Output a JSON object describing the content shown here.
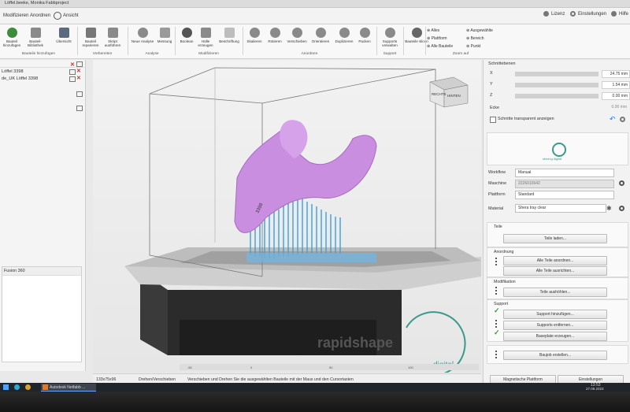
{
  "window": {
    "title": "Löffel.beeke, Monika Fabbproject"
  },
  "menubar": {
    "items": [
      "Modifizieren",
      "Anordnen",
      "Ansicht"
    ],
    "license": "Lizenz",
    "settings": "Einstellungen",
    "help": "Hilfe"
  },
  "ribbon": {
    "buttons": [
      {
        "label": "Bauteil hinzufügen",
        "icon": "add-part-icon"
      },
      {
        "label": "Bauteil-Bibliothek",
        "icon": "library-icon"
      },
      {
        "label": "Übersicht",
        "icon": "overview-icon"
      },
      {
        "label": "Bauteil reparieren",
        "icon": "repair-icon"
      },
      {
        "label": "Skript ausführen",
        "icon": "script-icon"
      },
      {
        "label": "Neue Analyse",
        "icon": "analysis-icon"
      },
      {
        "label": "Messung",
        "icon": "measure-icon"
      },
      {
        "label": "Boolean",
        "icon": "boolean-icon"
      },
      {
        "label": "Hülle erzeugen",
        "icon": "hull-icon"
      },
      {
        "label": "Beschriftung",
        "icon": "label-icon"
      },
      {
        "label": "Skalieren",
        "icon": "scale-icon"
      },
      {
        "label": "Rotieren",
        "icon": "rotate-icon"
      },
      {
        "label": "Verschieben",
        "icon": "move-icon"
      },
      {
        "label": "Orientieren",
        "icon": "orient-icon"
      },
      {
        "label": "Duplizieren",
        "icon": "duplicate-icon"
      },
      {
        "label": "Packen",
        "icon": "pack-icon"
      },
      {
        "label": "Supports verwalten",
        "icon": "supports-icon"
      },
      {
        "label": "Bauteile slicen",
        "icon": "slice-icon"
      }
    ],
    "groups": [
      "Bauteile hinzufügen",
      "Vorbereiten",
      "Analyse",
      "Modifizieren",
      "Anordnen",
      "Support",
      "Zoom auf"
    ],
    "zoom_options": [
      "Alles",
      "Plattform",
      "Alle Bauteile"
    ],
    "selection_options": [
      "Ausgewählte",
      "Bereich",
      "Punkt"
    ]
  },
  "left_panel": {
    "parts": [
      "Löffel 3398",
      "de_UK Löffel 3398"
    ],
    "lower_box_title": "Fusion 360"
  },
  "right_panel": {
    "section_title": "Schnittebenen",
    "axes": [
      {
        "label": "X",
        "value": "24.75 mm"
      },
      {
        "label": "Y",
        "value": "1.54 mm"
      },
      {
        "label": "Z",
        "value": "0.00 mm"
      }
    ],
    "edge_label": "Ecke",
    "edge_value": "0.00 mm",
    "transparent_label": "Schnitte transparent anzeigen",
    "logo_text": "shining digital",
    "workflow_label": "Workflow",
    "workflow_value": "Manual",
    "machine_label": "Maschine",
    "machine_value": "2226010642",
    "platform_label": "Plattform",
    "platform_value": "Standard",
    "material_label": "Material",
    "material_value": "Shera tray clear",
    "sections": [
      {
        "title": "Teile",
        "button": "Teile laden..."
      },
      {
        "title": "Anordnung",
        "buttons": [
          "Alle Teile anordnen...",
          "Alle Teile ausrichten..."
        ]
      },
      {
        "title": "Modifikation",
        "button": "Teile aushöhlen..."
      },
      {
        "title": "Support",
        "buttons": [
          "Support hinzufügen...",
          "Supports entfernen...",
          "Baseplate erzeugen..."
        ]
      },
      {
        "button": "Baujob erstellen..."
      }
    ],
    "bottom_buttons": [
      "Magnetische Plattform",
      "Einstellungen"
    ]
  },
  "viewport": {
    "cube_front": "RECHTS",
    "cube_side": "HINTEN",
    "watermark_main": "rapidshape",
    "watermark_sub": "digital",
    "part_text": "3398",
    "ruler": [
      "-50",
      "0",
      "50",
      "100"
    ]
  },
  "statusbar": {
    "size": "133x75x96",
    "mode": "Drehen/Verschieben",
    "hint": "Verschieben und Drehen Sie die ausgewählten Bauteile mit der Maus und den Cursortasten"
  },
  "taskbar": {
    "app": "Autodesk Netfabb ...",
    "time": "13:53",
    "date": "27.09.2023"
  },
  "colors": {
    "part": "#c98ee0",
    "supports": "#3d9fd8",
    "accent": "#2b7ad8"
  }
}
